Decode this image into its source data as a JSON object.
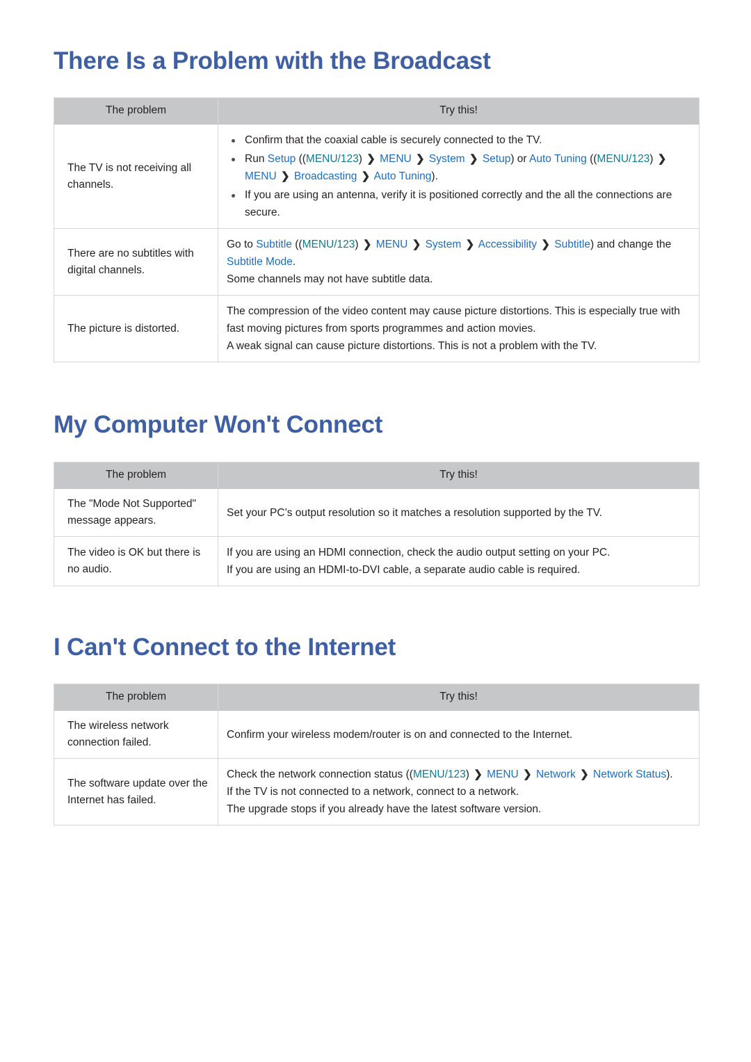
{
  "colors": {
    "heading_blue": "#3f5fa4",
    "link_blue": "#1a6ec4",
    "key_teal": "#0d7b91",
    "header_gray": "#c6c7c9",
    "border_gray": "#d5d6da",
    "text": "#231f20"
  },
  "table_headers": {
    "problem": "The problem",
    "try_this": "Try this!"
  },
  "glyphs": {
    "arrow": "❯"
  },
  "sections": [
    {
      "id": "broadcast",
      "title": "There Is a Problem with the Broadcast",
      "rows": [
        {
          "problem": "The TV is not receiving all channels.",
          "type": "bullets",
          "bullets": [
            [
              {
                "t": "Confirm that the coaxial cable is securely connected to the TV.",
                "s": "plain"
              }
            ],
            [
              {
                "t": "Run ",
                "s": "plain"
              },
              {
                "t": "Setup",
                "s": "link"
              },
              {
                "t": " ((",
                "s": "plain"
              },
              {
                "t": "MENU/123",
                "s": "key"
              },
              {
                "t": ") ",
                "s": "plain"
              },
              {
                "t": "❯",
                "s": "arrow"
              },
              {
                "t": " ",
                "s": "plain"
              },
              {
                "t": "MENU",
                "s": "link"
              },
              {
                "t": " ",
                "s": "plain"
              },
              {
                "t": "❯",
                "s": "arrow"
              },
              {
                "t": " ",
                "s": "plain"
              },
              {
                "t": "System",
                "s": "link"
              },
              {
                "t": " ",
                "s": "plain"
              },
              {
                "t": "❯",
                "s": "arrow"
              },
              {
                "t": " ",
                "s": "plain"
              },
              {
                "t": "Setup",
                "s": "link"
              },
              {
                "t": ") or ",
                "s": "plain"
              },
              {
                "t": "Auto Tuning",
                "s": "link"
              },
              {
                "t": " ((",
                "s": "plain"
              },
              {
                "t": "MENU/123",
                "s": "key"
              },
              {
                "t": ") ",
                "s": "plain"
              },
              {
                "t": "❯",
                "s": "arrow"
              },
              {
                "t": " ",
                "s": "plain"
              },
              {
                "t": "MENU",
                "s": "link"
              },
              {
                "t": " ",
                "s": "plain"
              },
              {
                "t": "❯",
                "s": "arrow"
              },
              {
                "t": " ",
                "s": "plain"
              },
              {
                "t": "Broadcasting",
                "s": "link"
              },
              {
                "t": " ",
                "s": "plain"
              },
              {
                "t": "❯",
                "s": "arrow"
              },
              {
                "t": " ",
                "s": "plain"
              },
              {
                "t": "Auto Tuning",
                "s": "link"
              },
              {
                "t": ").",
                "s": "plain"
              }
            ],
            [
              {
                "t": "If you are using an antenna, verify it is positioned correctly and the all the connections are secure.",
                "s": "plain"
              }
            ]
          ]
        },
        {
          "problem": "There are no subtitles with digital channels.",
          "type": "lines",
          "lines": [
            [
              {
                "t": "Go to ",
                "s": "plain"
              },
              {
                "t": "Subtitle",
                "s": "link"
              },
              {
                "t": " ((",
                "s": "plain"
              },
              {
                "t": "MENU/123",
                "s": "key"
              },
              {
                "t": ") ",
                "s": "plain"
              },
              {
                "t": "❯",
                "s": "arrow"
              },
              {
                "t": " ",
                "s": "plain"
              },
              {
                "t": "MENU",
                "s": "link"
              },
              {
                "t": " ",
                "s": "plain"
              },
              {
                "t": "❯",
                "s": "arrow"
              },
              {
                "t": " ",
                "s": "plain"
              },
              {
                "t": "System",
                "s": "link"
              },
              {
                "t": " ",
                "s": "plain"
              },
              {
                "t": "❯",
                "s": "arrow"
              },
              {
                "t": " ",
                "s": "plain"
              },
              {
                "t": "Accessibility",
                "s": "link"
              },
              {
                "t": " ",
                "s": "plain"
              },
              {
                "t": "❯",
                "s": "arrow"
              },
              {
                "t": " ",
                "s": "plain"
              },
              {
                "t": "Subtitle",
                "s": "link"
              },
              {
                "t": ") and change the ",
                "s": "plain"
              },
              {
                "t": "Subtitle Mode",
                "s": "link"
              },
              {
                "t": ".",
                "s": "plain"
              }
            ],
            [
              {
                "t": "Some channels may not have subtitle data.",
                "s": "plain"
              }
            ]
          ]
        },
        {
          "problem": "The picture is distorted.",
          "type": "lines",
          "lines": [
            [
              {
                "t": "The compression of the video content may cause picture distortions. This is especially true with fast moving pictures from sports programmes and action movies.",
                "s": "plain"
              }
            ],
            [
              {
                "t": "A weak signal can cause picture distortions. This is not a problem with the TV.",
                "s": "plain"
              }
            ]
          ]
        }
      ]
    },
    {
      "id": "computer",
      "title": "My Computer Won't Connect",
      "rows": [
        {
          "problem": "The \"Mode Not Supported\" message appears.",
          "type": "lines",
          "lines": [
            [
              {
                "t": "Set your PC’s output resolution so it matches a resolution supported by the TV.",
                "s": "plain"
              }
            ]
          ]
        },
        {
          "problem": "The video is OK but there is no audio.",
          "type": "lines",
          "lines": [
            [
              {
                "t": "If you are using an HDMI connection, check the audio output setting on your PC.",
                "s": "plain"
              }
            ],
            [
              {
                "t": "If you are using an HDMI-to-DVI cable, a separate audio cable is required.",
                "s": "plain"
              }
            ]
          ]
        }
      ]
    },
    {
      "id": "internet",
      "title": "I Can't Connect to the Internet",
      "rows": [
        {
          "problem": "The wireless network connection failed.",
          "type": "lines",
          "lines": [
            [
              {
                "t": "Confirm your wireless modem/router is on and connected to the Internet.",
                "s": "plain"
              }
            ]
          ]
        },
        {
          "problem": "The software update over the Internet has failed.",
          "type": "lines",
          "lines": [
            [
              {
                "t": "Check the network connection status ((",
                "s": "plain"
              },
              {
                "t": "MENU/123",
                "s": "key"
              },
              {
                "t": ") ",
                "s": "plain"
              },
              {
                "t": "❯",
                "s": "arrow"
              },
              {
                "t": " ",
                "s": "plain"
              },
              {
                "t": "MENU",
                "s": "link"
              },
              {
                "t": " ",
                "s": "plain"
              },
              {
                "t": "❯",
                "s": "arrow"
              },
              {
                "t": " ",
                "s": "plain"
              },
              {
                "t": "Network",
                "s": "link"
              },
              {
                "t": " ",
                "s": "plain"
              },
              {
                "t": "❯",
                "s": "arrow"
              },
              {
                "t": " ",
                "s": "plain"
              },
              {
                "t": "Network Status",
                "s": "link"
              },
              {
                "t": ").",
                "s": "plain"
              }
            ],
            [
              {
                "t": "If the TV is not connected to a network, connect to a network.",
                "s": "plain"
              }
            ],
            [
              {
                "t": "The upgrade stops if you already have the latest software version.",
                "s": "plain"
              }
            ]
          ]
        }
      ]
    }
  ]
}
